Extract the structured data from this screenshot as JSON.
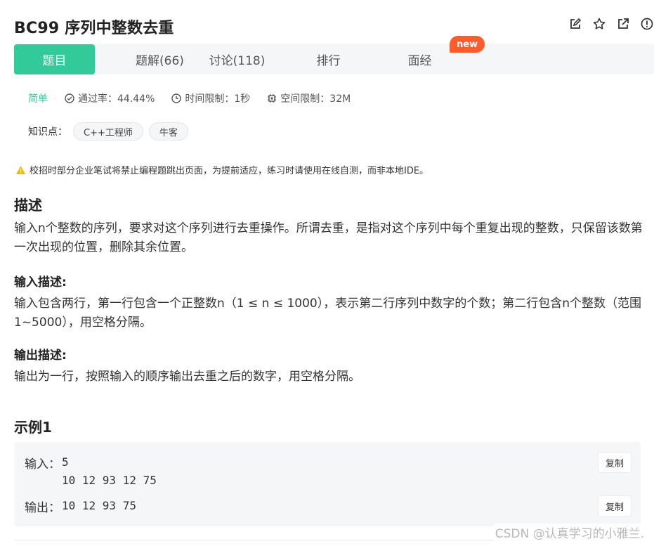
{
  "header": {
    "title": "BC99  序列中整数去重",
    "icons": [
      "edit-icon",
      "star-icon",
      "external-link-icon",
      "report-icon"
    ]
  },
  "tabs": [
    {
      "label": "题目",
      "active": true
    },
    {
      "label": "题解(66)",
      "active": false
    },
    {
      "label": "讨论(118)",
      "active": false
    },
    {
      "label": "排行",
      "active": false
    },
    {
      "label": "面经",
      "active": false
    }
  ],
  "new_badge": "new",
  "meta": {
    "difficulty": "简单",
    "pass_rate": "通过率：44.44%",
    "time_limit": "时间限制：1秒",
    "space_limit": "空间限制：32M"
  },
  "tags": {
    "label": "知识点：",
    "items": [
      "C++工程师",
      "牛客"
    ]
  },
  "warning": "校招时部分企业笔试将禁止编程题跳出页面，为提前适应，练习时请使用在线自测，而非本地IDE。",
  "description": {
    "title": "描述",
    "text": "输入n个整数的序列，要求对这个序列进行去重操作。所谓去重，是指对这个序列中每个重复出现的整数，只保留该数第一次出现的位置，删除其余位置。"
  },
  "input_desc": {
    "title": "输入描述:",
    "text": "输入包含两行，第一行包含一个正整数n（1 ≤ n ≤ 1000），表示第二行序列中数字的个数；第二行包含n个整数（范围1~5000），用空格分隔。"
  },
  "output_desc": {
    "title": "输出描述:",
    "text": "输出为一行，按照输入的顺序输出去重之后的数字，用空格分隔。"
  },
  "example": {
    "title": "示例1",
    "input_label": "输入：",
    "input_line1": "5",
    "input_line2": "10 12 93 12 75",
    "output_label": "输出：",
    "output_value": "10 12 93 75",
    "copy_label": "复制"
  },
  "watermark": "CSDN @认真学习的小雅兰.",
  "colors": {
    "accent": "#32ca99",
    "badge": "#ff5c2e",
    "warning_icon": "#f5b700"
  }
}
